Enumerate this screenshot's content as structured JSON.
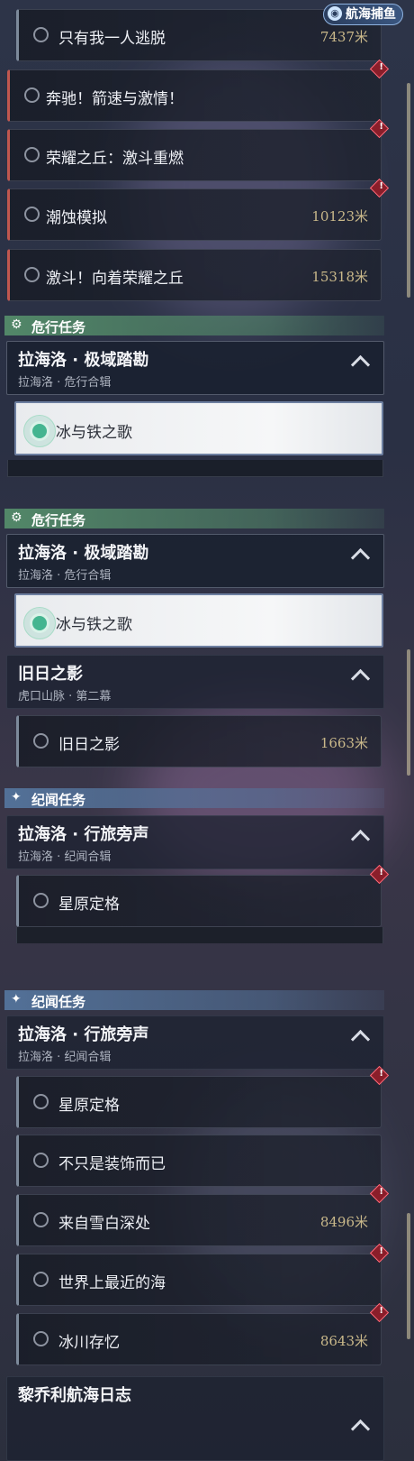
{
  "badge": {
    "label": "航海捕鱼"
  },
  "panel1": {
    "rows": [
      {
        "label": "只有我一人逃脱",
        "distance": "7437米"
      },
      {
        "label": "奔驰！箭速与激情！",
        "distance": ""
      },
      {
        "label": "荣耀之丘：激斗重燃",
        "distance": ""
      },
      {
        "label": "潮蚀模拟",
        "distance": "10123米"
      },
      {
        "label": "激斗！向着荣耀之丘",
        "distance": "15318米"
      }
    ],
    "category": "危行任务",
    "group": {
      "title": "拉海洛 · 极域踏勘",
      "subtitle": "拉海洛 · 危行合辑"
    },
    "selected": "冰与铁之歌"
  },
  "panel2": {
    "category": "危行任务",
    "group": {
      "title": "拉海洛 · 极域踏勘",
      "subtitle": "拉海洛 · 危行合辑"
    },
    "selected": "冰与铁之歌",
    "group2": {
      "title": "旧日之影",
      "subtitle": "虎口山脉 · 第二幕"
    },
    "row": {
      "label": "旧日之影",
      "distance": "1663米"
    },
    "category2": "纪闻任务",
    "group3": {
      "title": "拉海洛 · 行旅旁声",
      "subtitle": "拉海洛 · 纪闻合辑"
    },
    "row2": {
      "label": "星原定格",
      "distance": ""
    }
  },
  "panel3": {
    "category": "纪闻任务",
    "group": {
      "title": "拉海洛 · 行旅旁声",
      "subtitle": "拉海洛 · 纪闻合辑"
    },
    "rows": [
      {
        "label": "星原定格",
        "distance": ""
      },
      {
        "label": "不只是装饰而已",
        "distance": ""
      },
      {
        "label": "来自雪白深处",
        "distance": "8496米"
      },
      {
        "label": "世界上最近的海",
        "distance": ""
      },
      {
        "label": "冰川存忆",
        "distance": "8643米"
      }
    ],
    "group2": {
      "title": "黎乔利航海日志"
    }
  },
  "icons": {
    "alert": "!",
    "category_task": "gear-icon",
    "category_lore": "sparkle-icon"
  },
  "colors": {
    "distance": "#c9b88a",
    "alert": "#ff6b7a",
    "category_green": "#548c6a",
    "category_blue": "#54749c"
  }
}
